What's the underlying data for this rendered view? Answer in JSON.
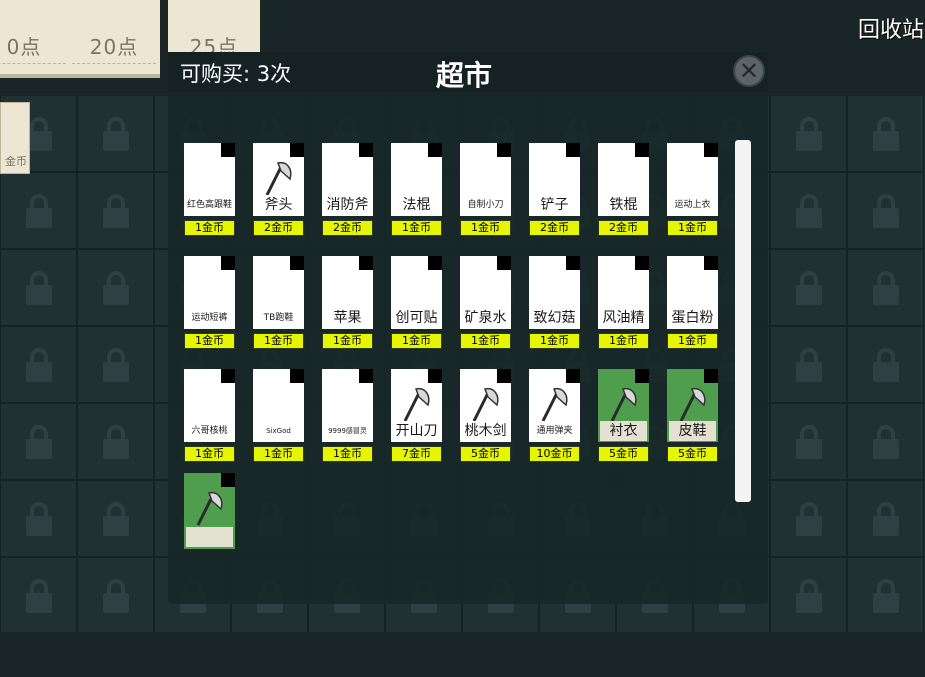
{
  "top_cards": [
    {
      "value": "0点"
    },
    {
      "value": "20点"
    },
    {
      "value": "25点"
    }
  ],
  "recycle_label": "回收站",
  "side_card_label": "金币",
  "purchase": {
    "text": "可购买: 3次"
  },
  "shop": {
    "title": "超市"
  },
  "close_icon": "close-icon",
  "items": [
    {
      "name": "红色高跟鞋",
      "price": "1金币",
      "icon": "none",
      "style": "white"
    },
    {
      "name": "斧头",
      "price": "2金币",
      "icon": "axe-icon",
      "style": "white"
    },
    {
      "name": "消防斧",
      "price": "2金币",
      "icon": "none",
      "style": "white"
    },
    {
      "name": "法棍",
      "price": "1金币",
      "icon": "none",
      "style": "white"
    },
    {
      "name": "自制小刀",
      "price": "1金币",
      "icon": "none",
      "style": "white"
    },
    {
      "name": "铲子",
      "price": "2金币",
      "icon": "none",
      "style": "white"
    },
    {
      "name": "铁棍",
      "price": "2金币",
      "icon": "none",
      "style": "white"
    },
    {
      "name": "运动上衣",
      "price": "1金币",
      "icon": "none",
      "style": "white"
    },
    {
      "name": "运动短裤",
      "price": "1金币",
      "icon": "none",
      "style": "white"
    },
    {
      "name": "TB跑鞋",
      "price": "1金币",
      "icon": "none",
      "style": "white"
    },
    {
      "name": "苹果",
      "price": "1金币",
      "icon": "none",
      "style": "white"
    },
    {
      "name": "创可贴",
      "price": "1金币",
      "icon": "none",
      "style": "white"
    },
    {
      "name": "矿泉水",
      "price": "1金币",
      "icon": "none",
      "style": "white"
    },
    {
      "name": "致幻菇",
      "price": "1金币",
      "icon": "none",
      "style": "white"
    },
    {
      "name": "风油精",
      "price": "1金币",
      "icon": "none",
      "style": "white"
    },
    {
      "name": "蛋白粉",
      "price": "1金币",
      "icon": "none",
      "style": "white"
    },
    {
      "name": "六哥核桃",
      "price": "1金币",
      "icon": "none",
      "style": "white"
    },
    {
      "name": "SixGod",
      "price": "1金币",
      "icon": "none",
      "style": "white"
    },
    {
      "name": "9999感冒灵",
      "price": "1金币",
      "icon": "none",
      "style": "white"
    },
    {
      "name": "开山刀",
      "price": "7金币",
      "icon": "axe-icon",
      "style": "white"
    },
    {
      "name": "桃木剑",
      "price": "5金币",
      "icon": "axe-icon",
      "style": "white"
    },
    {
      "name": "通用弹夹",
      "price": "10金币",
      "icon": "axe-icon",
      "style": "white"
    },
    {
      "name": "衬衣",
      "price": "5金币",
      "icon": "axe-icon",
      "style": "green"
    },
    {
      "name": "皮鞋",
      "price": "5金币",
      "icon": "axe-icon",
      "style": "green"
    }
  ],
  "extra_item": {
    "icon": "axe-icon",
    "style": "green"
  },
  "colors": {
    "price_bg": "#e6f500",
    "green_card": "#4e9e4e"
  }
}
